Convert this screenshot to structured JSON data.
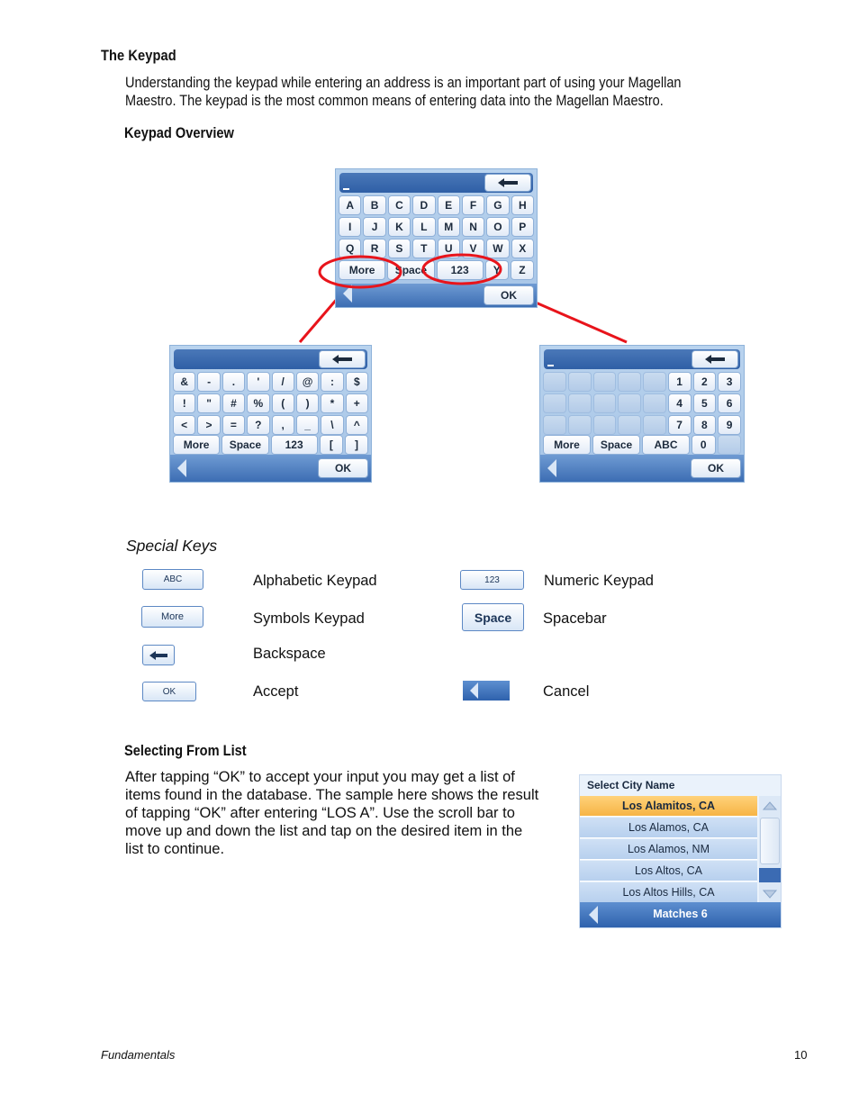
{
  "heading": "The Keypad",
  "intro": "Understanding the keypad while entering an address is an important part of using your Magellan Maestro.  The keypad is the most common means of entering data into the Magellan Maestro.",
  "intro_lines": [
    "Understanding the keypad while entering an address is an important part of using your Magellan",
    "Maestro.  The keypad is the most common means of entering data into the Magellan Maestro."
  ],
  "overview_heading": "Keypad Overview",
  "keypads": {
    "alpha": {
      "input_value": "_",
      "rows": [
        [
          "A",
          "B",
          "C",
          "D",
          "E",
          "F",
          "G",
          "H"
        ],
        [
          "I",
          "J",
          "K",
          "L",
          "M",
          "N",
          "O",
          "P"
        ],
        [
          "Q",
          "R",
          "S",
          "T",
          "U",
          "V",
          "W",
          "X"
        ]
      ],
      "bottom_row": [
        "More",
        "Space",
        "123",
        "Y",
        "Z"
      ],
      "ok_label": "OK"
    },
    "symbols": {
      "input_value": "",
      "rows": [
        [
          "&",
          "-",
          ".",
          "'",
          "/",
          "@",
          ":",
          "$"
        ],
        [
          "!",
          "\"",
          "#",
          "%",
          "(",
          ")",
          "*",
          "+"
        ],
        [
          "<",
          ">",
          "=",
          "?",
          ",",
          "_",
          "\\",
          "^"
        ]
      ],
      "bottom_row": [
        "More",
        "Space",
        "123",
        "[",
        "]"
      ],
      "ok_label": "OK"
    },
    "numeric": {
      "input_value": "_",
      "rows": [
        [
          "",
          "",
          "",
          "",
          "",
          "1",
          "2",
          "3"
        ],
        [
          "",
          "",
          "",
          "",
          "",
          "4",
          "5",
          "6"
        ],
        [
          "",
          "",
          "",
          "",
          "",
          "7",
          "8",
          "9"
        ]
      ],
      "bottom_row": [
        "More",
        "Space",
        "ABC",
        "0",
        ""
      ],
      "ok_label": "OK"
    }
  },
  "callout_color": "#e8141b",
  "special_keys": {
    "heading": "Special Keys",
    "items": [
      {
        "icon_label": "ABC",
        "description": "Alphabetic Keypad"
      },
      {
        "icon_label": "123",
        "description": "Numeric Keypad"
      },
      {
        "icon_label": "More",
        "description": "Symbols Keypad"
      },
      {
        "icon_label": "Space",
        "description": "Spacebar"
      },
      {
        "icon_label": "backspace-arrow",
        "description": "Backspace"
      },
      {
        "icon_label": "OK",
        "description": "Accept"
      },
      {
        "icon_label": "cancel-triangle",
        "description": "Cancel"
      }
    ]
  },
  "selecting": {
    "heading": "Selecting From List",
    "lines": [
      "After tapping “OK” to accept your input you may get a list of",
      "items found in the database.  The sample here shows the result",
      "of tapping “OK” after entering “LOS A”.  Use the scroll bar to",
      "move up and down the list and tap on the desired item in the",
      "list to continue."
    ],
    "list_screen": {
      "title": "Select City Name",
      "items": [
        "Los Alamitos, CA",
        "Los Alamos, CA",
        "Los Alamos, NM",
        "Los Altos, CA",
        "Los Altos Hills, CA"
      ],
      "selected_index": 0,
      "footer": "Matches  6",
      "selected_color": "#f6b445"
    }
  },
  "footer": {
    "section": "Fundamentals",
    "page_number": "10"
  }
}
